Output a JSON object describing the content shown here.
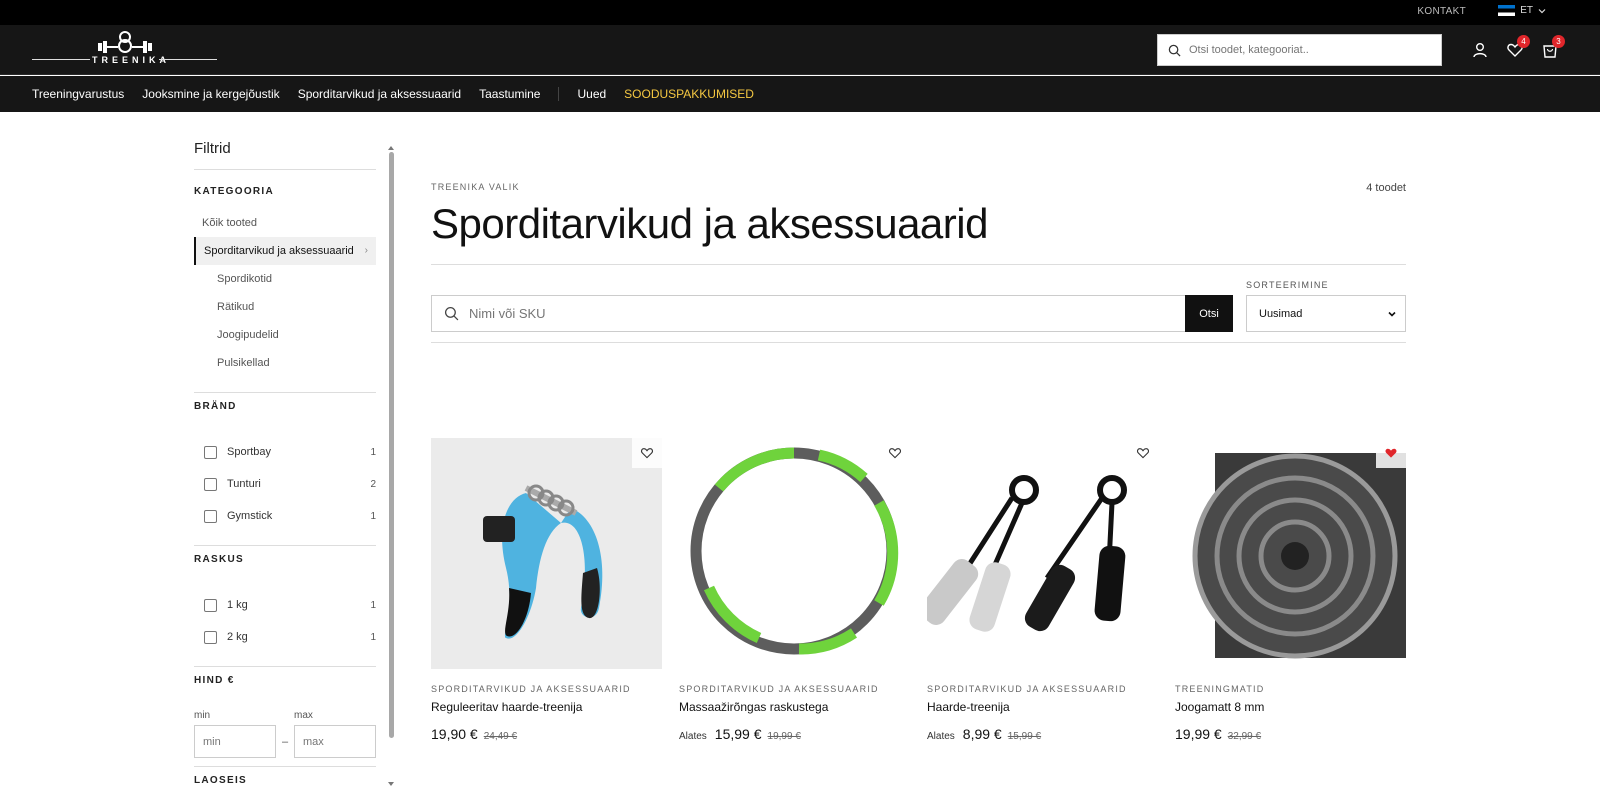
{
  "topbar": {
    "contact": "KONTAKT",
    "lang": "ET"
  },
  "header": {
    "logo_text": "TREENIKA",
    "search_placeholder": "Otsi toodet, kategooriat..",
    "wishlist_count": "4",
    "cart_count": "3"
  },
  "nav": {
    "items": [
      "Treeningvarustus",
      "Jooksmine ja kergejõustik",
      "Sporditarvikud ja aksessuaarid",
      "Taastumine"
    ],
    "new_label": "Uued",
    "promo_label": "SOODUSPAKKUMISED"
  },
  "sidebar": {
    "title": "Filtrid",
    "category_heading": "KATEGOORIA",
    "categories": {
      "all": "Kõik tooted",
      "active": "Sporditarvikud ja aksessuaarid",
      "subs": [
        "Spordikotid",
        "Rätikud",
        "Joogipudelid",
        "Pulsikellad"
      ]
    },
    "brand_heading": "BRÄND",
    "brands": [
      {
        "label": "Sportbay",
        "count": "1"
      },
      {
        "label": "Tunturi",
        "count": "2"
      },
      {
        "label": "Gymstick",
        "count": "1"
      }
    ],
    "weight_heading": "RASKUS",
    "weights": [
      {
        "label": "1 kg",
        "count": "1"
      },
      {
        "label": "2 kg",
        "count": "1"
      }
    ],
    "price_heading": "HIND €",
    "min_label": "min",
    "max_label": "max",
    "min_placeholder": "min",
    "max_placeholder": "max",
    "stock_heading": "LAOSEIS"
  },
  "main": {
    "eyebrow": "TREENIKA VALIK",
    "count": "4 toodet",
    "title": "Sporditarvikud ja aksessuaarid",
    "search_placeholder": "Nimi või SKU",
    "search_button": "Otsi",
    "sort_label": "SORTEERIMINE",
    "sort_value": "Uusimad"
  },
  "products": [
    {
      "category": "SPORDITARVIKUD JA AKSESSUAARID",
      "name": "Reguleeritav haarde-treenija",
      "from": "",
      "price": "19,90 €",
      "old": "24,49 €",
      "wishlisted": "no"
    },
    {
      "category": "SPORDITARVIKUD JA AKSESSUAARID",
      "name": "Massaažirõngas raskustega",
      "from": "Alates",
      "price": "15,99 €",
      "old": "19,99 €",
      "wishlisted": "no"
    },
    {
      "category": "SPORDITARVIKUD JA AKSESSUAARID",
      "name": "Haarde-treenija",
      "from": "Alates",
      "price": "8,99 €",
      "old": "15,99 €",
      "wishlisted": "no"
    },
    {
      "category": "TREENINGMATID",
      "name": "Joogamatt 8 mm",
      "from": "",
      "price": "19,99 €",
      "old": "32,99 €",
      "wishlisted": "yes"
    }
  ],
  "colors": {
    "promo": "#f5c842",
    "badge": "#e0262b",
    "wish_active": "#e0262b",
    "header_bg": "#161616"
  },
  "icons": [
    "search-icon",
    "user-icon",
    "heart-icon",
    "cart-icon",
    "chevron-down-icon",
    "estonia-flag-icon"
  ]
}
